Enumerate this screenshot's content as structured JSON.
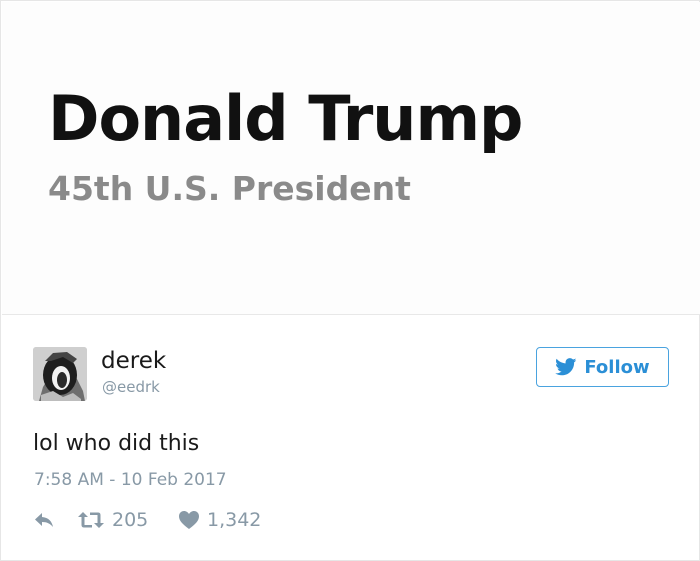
{
  "image": {
    "title": "Donald Trump",
    "subtitle": "45th U.S. President"
  },
  "tweet": {
    "display_name": "derek",
    "handle": "@eedrk",
    "follow_label": "Follow",
    "text": "lol who did this",
    "timestamp": "7:58 AM - 10 Feb 2017",
    "retweet_count": "205",
    "like_count": "1,342"
  },
  "colors": {
    "accent": "#2b8fd6",
    "muted": "#8899a6",
    "text": "#1a1a1a"
  },
  "icons": {
    "reply": "reply-icon",
    "retweet": "retweet-icon",
    "like": "heart-icon",
    "brand": "twitter-bird-icon"
  }
}
